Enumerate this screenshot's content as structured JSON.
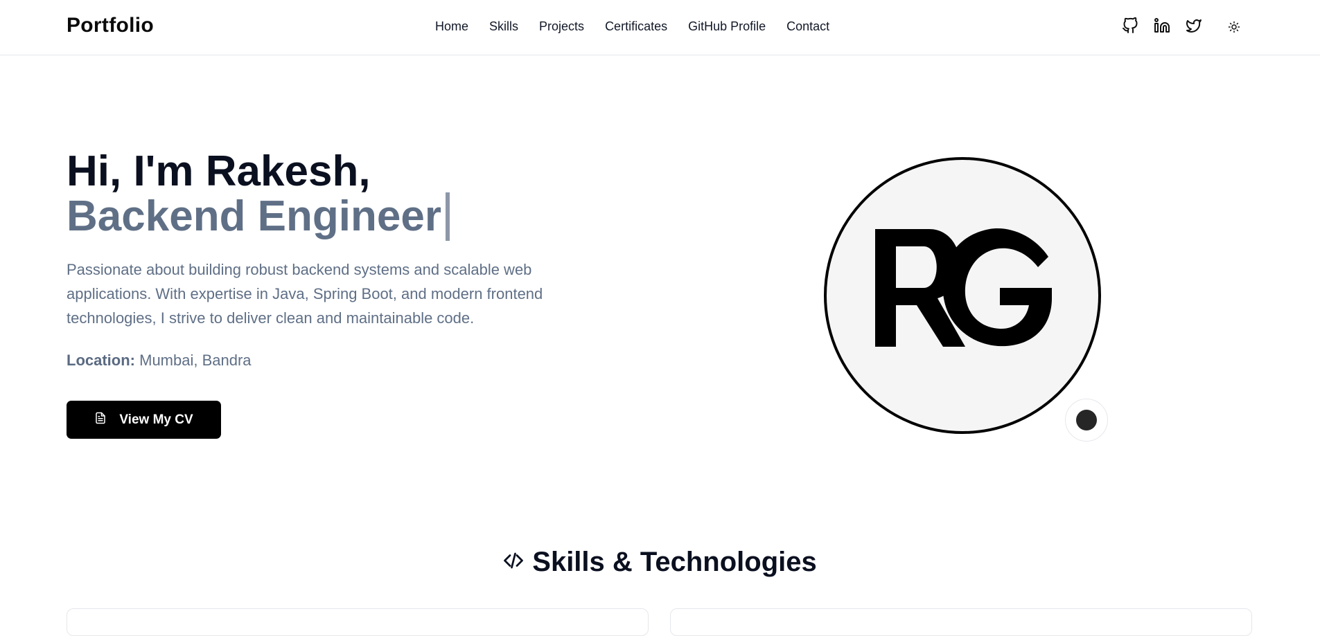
{
  "header": {
    "brand": "Portfolio",
    "nav": [
      "Home",
      "Skills",
      "Projects",
      "Certificates",
      "GitHub Profile",
      "Contact"
    ],
    "social_icons": [
      "github-icon",
      "linkedin-icon",
      "twitter-icon"
    ],
    "theme_icon": "sun-icon"
  },
  "hero": {
    "greeting": "Hi, I'm Rakesh,",
    "role": "Backend Engineer",
    "description": "Passionate about building robust backend systems and scalable web applications. With expertise in Java, Spring Boot, and modern frontend technologies, I strive to deliver clean and maintainable code.",
    "location_label": "Location:",
    "location_value": "Mumbai, Bandra",
    "cv_button": "View My CV",
    "logo_monogram": "RG"
  },
  "skills": {
    "title": "Skills & Technologies",
    "icon": "code-icon"
  },
  "colors": {
    "muted_text": "#5f6f86",
    "dark_text": "#0b1020",
    "button_bg": "#000000"
  }
}
